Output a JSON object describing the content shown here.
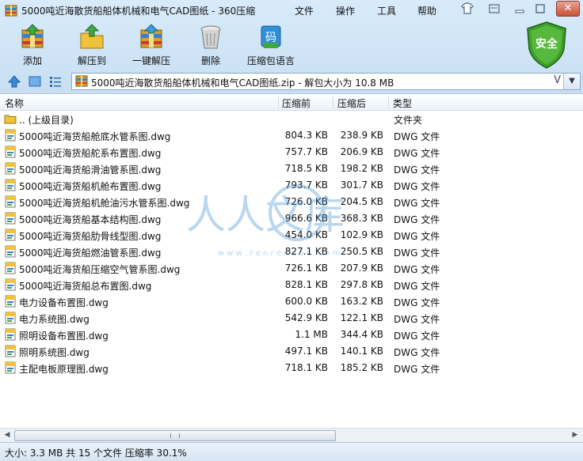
{
  "window": {
    "title": "5000吨近海散货船船体机械和电气CAD图纸 - 360压缩",
    "menu": [
      "文件",
      "操作",
      "工具",
      "帮助"
    ]
  },
  "toolbar": {
    "items": [
      {
        "label": "添加",
        "icon": "add-archive-icon"
      },
      {
        "label": "解压到",
        "icon": "extract-to-icon"
      },
      {
        "label": "一键解压",
        "icon": "one-click-extract-icon"
      },
      {
        "label": "删除",
        "icon": "delete-trash-icon"
      },
      {
        "label": "压缩包语言",
        "icon": "archive-language-icon"
      }
    ],
    "language_glyph": "码",
    "safe_label": "安全"
  },
  "address": {
    "path": "5000吨近海散货船船体机械和电气CAD图纸.zip - 解包大小为 10.8 MB",
    "v_glyph": "V"
  },
  "columns": {
    "name": "名称",
    "size": "压缩前",
    "compressed": "压缩后",
    "type": "类型"
  },
  "parent_row": {
    "name": ".. (上级目录)",
    "type": "文件夹"
  },
  "files": [
    {
      "name": "5000吨近海货船舱底水管系图.dwg",
      "size": "804.3 KB",
      "compressed": "238.9 KB",
      "type": "DWG 文件"
    },
    {
      "name": "5000吨近海货船舵系布置图.dwg",
      "size": "757.7 KB",
      "compressed": "206.9 KB",
      "type": "DWG 文件"
    },
    {
      "name": "5000吨近海货船滑油管系图.dwg",
      "size": "718.5 KB",
      "compressed": "198.2 KB",
      "type": "DWG 文件"
    },
    {
      "name": "5000吨近海货船机舱布置图.dwg",
      "size": "793.7 KB",
      "compressed": "301.7 KB",
      "type": "DWG 文件"
    },
    {
      "name": "5000吨近海货船机舱油污水管系图.dwg",
      "size": "726.0 KB",
      "compressed": "204.5 KB",
      "type": "DWG 文件"
    },
    {
      "name": "5000吨近海货船基本结构图.dwg",
      "size": "966.6 KB",
      "compressed": "368.3 KB",
      "type": "DWG 文件"
    },
    {
      "name": "5000吨近海货船肋骨线型图.dwg",
      "size": "454.0 KB",
      "compressed": "102.9 KB",
      "type": "DWG 文件"
    },
    {
      "name": "5000吨近海货船燃油管系图.dwg",
      "size": "827.1 KB",
      "compressed": "250.5 KB",
      "type": "DWG 文件"
    },
    {
      "name": "5000吨近海货船压缩空气管系图.dwg",
      "size": "726.1 KB",
      "compressed": "207.9 KB",
      "type": "DWG 文件"
    },
    {
      "name": "5000吨近海货船总布置图.dwg",
      "size": "828.1 KB",
      "compressed": "297.8 KB",
      "type": "DWG 文件"
    },
    {
      "name": "电力设备布置图.dwg",
      "size": "600.0 KB",
      "compressed": "163.2 KB",
      "type": "DWG 文件"
    },
    {
      "name": "电力系统图.dwg",
      "size": "542.9 KB",
      "compressed": "122.1 KB",
      "type": "DWG 文件"
    },
    {
      "name": "照明设备布置图.dwg",
      "size": "1.1 MB",
      "compressed": "344.4 KB",
      "type": "DWG 文件"
    },
    {
      "name": "照明系统图.dwg",
      "size": "497.1 KB",
      "compressed": "140.1 KB",
      "type": "DWG 文件"
    },
    {
      "name": "主配电板原理图.dwg",
      "size": "718.1 KB",
      "compressed": "185.2 KB",
      "type": "DWG 文件"
    }
  ],
  "watermark": {
    "text": "人人文库",
    "subtext": "w w w . r e n r e n d o c . c o m"
  },
  "status": "大小: 3.3 MB 共 15 个文件 压缩率 30.1%"
}
